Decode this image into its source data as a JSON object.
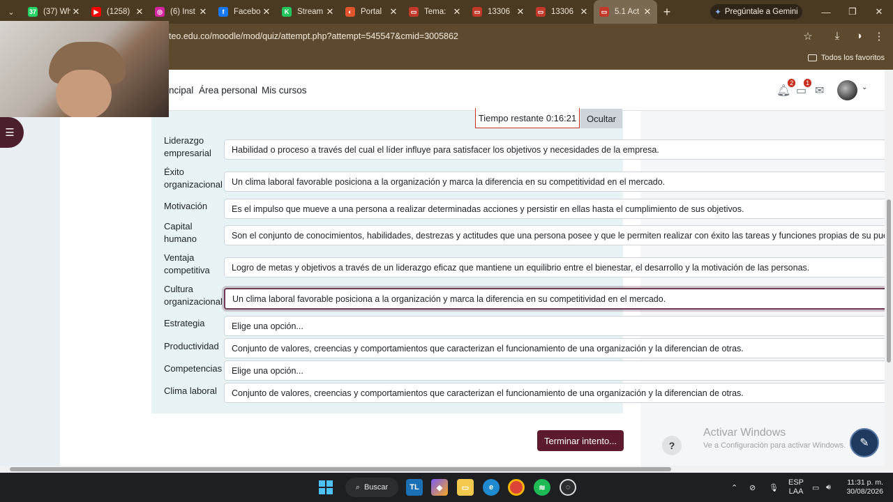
{
  "browser": {
    "tabs": [
      {
        "label": "(37) Wh",
        "icon": "whatsapp-icon",
        "color": "#25d366",
        "glyph": "37"
      },
      {
        "label": "(1258)",
        "icon": "youtube-icon",
        "color": "#ff0000",
        "glyph": "▶"
      },
      {
        "label": "(6) Inst",
        "icon": "instagram-icon",
        "color": "#d6249f",
        "glyph": "◎"
      },
      {
        "label": "Facebo",
        "icon": "facebook-icon",
        "color": "#1877f2",
        "glyph": "f"
      },
      {
        "label": "Stream",
        "icon": "stream-icon",
        "color": "#22c55e",
        "glyph": "K"
      },
      {
        "label": "Portal",
        "icon": "portal-icon",
        "color": "#e0542e",
        "glyph": "◐"
      },
      {
        "label": "Tema:",
        "icon": "tema-icon",
        "color": "#c0392b",
        "glyph": "▭"
      },
      {
        "label": "13306",
        "icon": "doc-icon",
        "color": "#c0392b",
        "glyph": "▭"
      },
      {
        "label": "13306",
        "icon": "doc-icon",
        "color": "#c0392b",
        "glyph": "▭"
      },
      {
        "label": "5.1 Act",
        "icon": "moodle-icon",
        "color": "#c0392b",
        "glyph": "▭"
      }
    ],
    "gemini_label": "Pregúntale a Gemini",
    "url": "teo.edu.co/moodle/mod/quiz/attempt.php?attempt=545547&cmid=3005862",
    "bookmarks_all": "Todos los favoritos"
  },
  "nav": {
    "links": [
      "ncipal",
      "Área personal",
      "Mis cursos"
    ],
    "notifications_count": "2",
    "messages_count": "1"
  },
  "quiz": {
    "timer": "Tiempo restante 0:16:21",
    "hide_label": "Ocultar",
    "rows": [
      {
        "label": "Liderazgo empresarial",
        "answer": "Habilidad o proceso a través del cual el líder influye para satisfacer los objetivos y necesidades de la empresa."
      },
      {
        "label": "Éxito organizacional",
        "answer": "Un clima laboral favorable posiciona a la organización y marca la diferencia en su competitividad en el mercado."
      },
      {
        "label": "Motivación",
        "answer": "Es el impulso que mueve a una persona a realizar determinadas acciones y persistir en ellas hasta el cumplimiento de sus objetivos."
      },
      {
        "label": "Capital humano",
        "answer": "Son el conjunto de conocimientos, habilidades, destrezas y actitudes que una persona posee y que le permiten realizar con éxito las tareas y funciones propias de su pue"
      },
      {
        "label": "Ventaja competitiva",
        "answer": "Logro de metas y objetivos a través de un liderazgo eficaz que mantiene un equilibrio entre el bienestar, el desarrollo y la motivación de las personas."
      },
      {
        "label": "Cultura organizacional",
        "answer": "Un clima laboral favorable posiciona a la organización y marca la diferencia en su competitividad en el mercado."
      },
      {
        "label": "Estrategia",
        "answer": "Elige una opción..."
      },
      {
        "label": "Productividad",
        "answer": "Conjunto de valores, creencias y comportamientos que caracterizan el funcionamiento de una organización y la diferencian de otras."
      },
      {
        "label": "Competencias",
        "answer": "Elige una opción..."
      },
      {
        "label": "Clima laboral",
        "answer": "Conjunto de valores, creencias y comportamientos que caracterizan el funcionamiento de una organización y la diferencian de otras."
      }
    ],
    "finish_label": "Terminar intento..."
  },
  "windows_watermark": {
    "title": "Activar Windows",
    "subtitle": "Ve a Configuración para activar Windows."
  },
  "help_label": "?",
  "taskbar": {
    "search_label": "Buscar",
    "lang_top": "ESP",
    "lang_bottom": "LAA",
    "time": "11:31 p. m.",
    "date": "30/08/2026"
  }
}
